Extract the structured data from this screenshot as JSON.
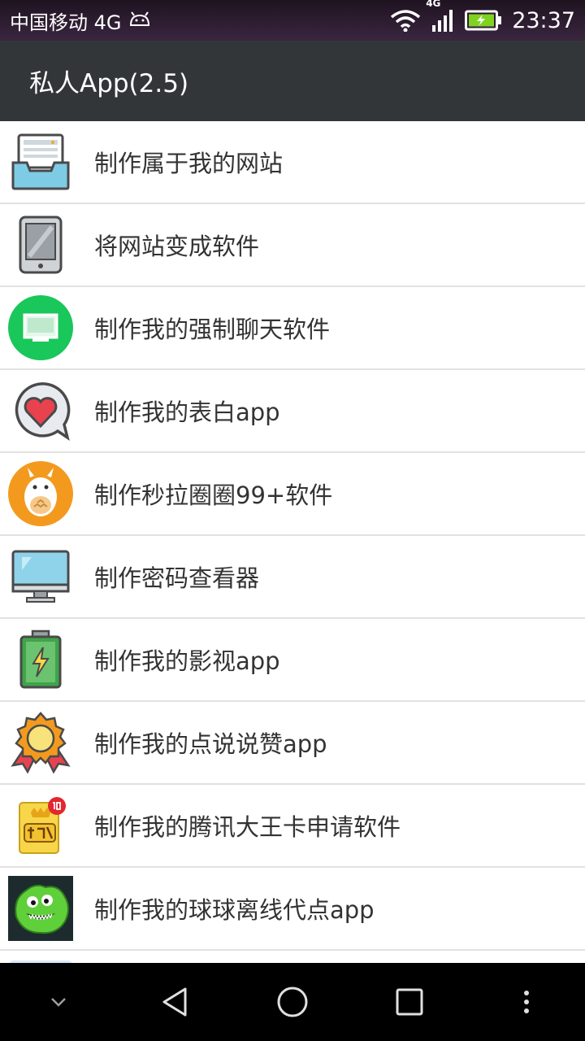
{
  "status_bar": {
    "carrier": "中国移动 4G",
    "network_badge": "4G",
    "time": "23:37",
    "icons": [
      "android-icon",
      "wifi-icon",
      "signal-icon",
      "battery-charging-icon"
    ]
  },
  "app_bar": {
    "title": "私人App(2.5)"
  },
  "list": {
    "items": [
      {
        "label": "制作属于我的网站",
        "icon": "inbox-tray-icon"
      },
      {
        "label": "将网站变成软件",
        "icon": "tablet-icon"
      },
      {
        "label": "制作我的强制聊天软件",
        "icon": "monitor-green-icon"
      },
      {
        "label": "制作我的表白app",
        "icon": "heart-bubble-icon"
      },
      {
        "label": "制作秒拉圈圈99+软件",
        "icon": "totoro-icon"
      },
      {
        "label": "制作密码查看器",
        "icon": "desktop-monitor-icon"
      },
      {
        "label": "制作我的影视app",
        "icon": "battery-bolt-icon"
      },
      {
        "label": "制作我的点说说赞app",
        "icon": "medal-badge-icon"
      },
      {
        "label": "制作我的腾讯大王卡申请软件",
        "icon": "card-game-icon"
      },
      {
        "label": "制作我的球球离线代点app",
        "icon": "green-monster-icon"
      }
    ]
  },
  "nav_bar": {
    "buttons": [
      "chevron-down-icon",
      "back-triangle-icon",
      "home-circle-icon",
      "recents-square-icon",
      "more-dots-icon"
    ]
  }
}
